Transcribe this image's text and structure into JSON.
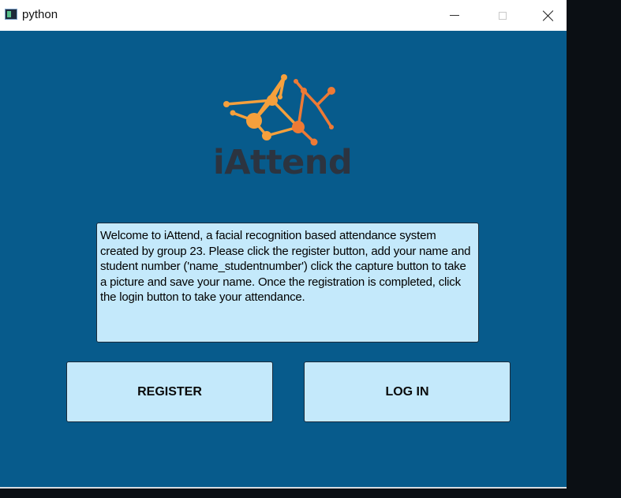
{
  "window": {
    "title": "python",
    "controls": {
      "minimize_icon": "minimize-icon",
      "maximize_icon": "maximize-icon",
      "close_icon": "close-icon"
    }
  },
  "colors": {
    "background": "#075b8c",
    "panel": "#c4e9fb",
    "logo_text": "#2c3440",
    "logo_orange": "#f5a03c",
    "logo_deep_orange": "#ee7a35"
  },
  "logo": {
    "text": "iAttend",
    "icon": "network-nodes-icon"
  },
  "welcome": {
    "text": "Welcome to iAttend, a facial recognition based attendance system created by group 23. Please click the register button, add your name and student number ('name_studentnumber') click the capture button to take a picture and save your name. Once the registration is completed, click the login button to take your attendance."
  },
  "buttons": {
    "register": "REGISTER",
    "login": "LOG IN"
  }
}
